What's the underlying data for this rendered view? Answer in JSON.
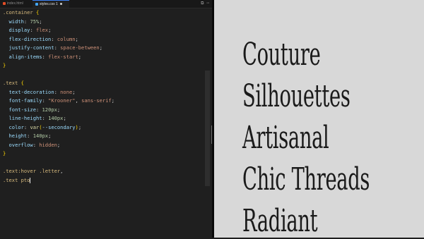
{
  "editor": {
    "tabs": [
      {
        "label": "index.html",
        "icon": "html-file-icon",
        "icon_color": "#e44d26"
      },
      {
        "label": "styles.css 1",
        "icon": "css-file-icon",
        "icon_color": "#42a5f5"
      }
    ],
    "code_lines": [
      [
        {
          "t": ".container ",
          "c": "sel"
        },
        {
          "t": "{",
          "c": "brace"
        }
      ],
      [
        {
          "t": "  width",
          "c": "prop"
        },
        {
          "t": ": ",
          "c": "punct"
        },
        {
          "t": "75%",
          "c": "num"
        },
        {
          "t": ";",
          "c": "punct"
        }
      ],
      [
        {
          "t": "  display",
          "c": "prop"
        },
        {
          "t": ": ",
          "c": "punct"
        },
        {
          "t": "flex",
          "c": "val"
        },
        {
          "t": ";",
          "c": "punct"
        }
      ],
      [
        {
          "t": "  flex-direction",
          "c": "prop"
        },
        {
          "t": ": ",
          "c": "punct"
        },
        {
          "t": "column",
          "c": "val"
        },
        {
          "t": ";",
          "c": "punct"
        }
      ],
      [
        {
          "t": "  justify-content",
          "c": "prop"
        },
        {
          "t": ": ",
          "c": "punct"
        },
        {
          "t": "space-between",
          "c": "val"
        },
        {
          "t": ";",
          "c": "punct"
        }
      ],
      [
        {
          "t": "  align-items",
          "c": "prop"
        },
        {
          "t": ": ",
          "c": "punct"
        },
        {
          "t": "flex-start",
          "c": "val"
        },
        {
          "t": ";",
          "c": "punct"
        }
      ],
      [
        {
          "t": "}",
          "c": "brace"
        }
      ],
      [
        {
          "t": "",
          "c": "punct"
        }
      ],
      [
        {
          "t": ".text ",
          "c": "sel"
        },
        {
          "t": "{",
          "c": "brace"
        }
      ],
      [
        {
          "t": "  text-decoration",
          "c": "prop"
        },
        {
          "t": ": ",
          "c": "punct"
        },
        {
          "t": "none",
          "c": "val"
        },
        {
          "t": ";",
          "c": "punct"
        }
      ],
      [
        {
          "t": "  font-family",
          "c": "prop"
        },
        {
          "t": ": ",
          "c": "punct"
        },
        {
          "t": "\"Krooner\"",
          "c": "val"
        },
        {
          "t": ", ",
          "c": "punct"
        },
        {
          "t": "sans-serif",
          "c": "val"
        },
        {
          "t": ";",
          "c": "punct"
        }
      ],
      [
        {
          "t": "  font-size",
          "c": "prop"
        },
        {
          "t": ": ",
          "c": "punct"
        },
        {
          "t": "120px",
          "c": "num"
        },
        {
          "t": ";",
          "c": "punct"
        }
      ],
      [
        {
          "t": "  line-height",
          "c": "prop"
        },
        {
          "t": ": ",
          "c": "punct"
        },
        {
          "t": "140px",
          "c": "num"
        },
        {
          "t": ";",
          "c": "punct"
        }
      ],
      [
        {
          "t": "  color",
          "c": "prop"
        },
        {
          "t": ": ",
          "c": "punct"
        },
        {
          "t": "var",
          "c": "fn"
        },
        {
          "t": "(",
          "c": "brace"
        },
        {
          "t": "--secondary",
          "c": "prop"
        },
        {
          "t": ")",
          "c": "brace"
        },
        {
          "t": ";",
          "c": "punct"
        }
      ],
      [
        {
          "t": "  height",
          "c": "prop"
        },
        {
          "t": ": ",
          "c": "punct"
        },
        {
          "t": "140px",
          "c": "num"
        },
        {
          "t": ";",
          "c": "punct"
        }
      ],
      [
        {
          "t": "  overflow",
          "c": "prop"
        },
        {
          "t": ": ",
          "c": "punct"
        },
        {
          "t": "hidden",
          "c": "val"
        },
        {
          "t": ";",
          "c": "punct"
        }
      ],
      [
        {
          "t": "}",
          "c": "brace"
        }
      ],
      [
        {
          "t": "",
          "c": "punct"
        }
      ],
      [
        {
          "t": ".text:hover .letter",
          "c": "sel"
        },
        {
          "t": ",",
          "c": "punct"
        }
      ],
      [
        {
          "t": ".text p",
          "c": "sel"
        },
        {
          "t": "to",
          "c": "sel"
        },
        {
          "t": "|",
          "c": "cursor"
        }
      ]
    ],
    "tab_actions": [
      "⧉",
      "⋯"
    ]
  },
  "preview": {
    "words": [
      "Couture",
      "Silhouettes",
      "Artisanal",
      "Chic Threads",
      "Radiant"
    ]
  },
  "colors": {
    "editor_bg": "#1f1f1f",
    "preview_bg": "#d8d8d8",
    "preview_text": "#1a1a1a"
  }
}
